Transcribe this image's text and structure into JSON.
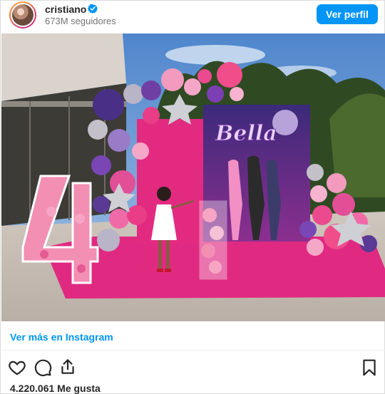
{
  "header": {
    "username": "cristiano",
    "followers": "673M seguidores",
    "follow_label": "Ver perfil"
  },
  "post": {
    "image_alt": "Bella",
    "backdrop_text": "Bella",
    "number_prop": "4"
  },
  "footer": {
    "more_link": "Ver más en Instagram",
    "likes": "4.220.061 Me gusta"
  },
  "icons": {
    "verified": "verified-badge-icon",
    "like": "heart-icon",
    "comment": "comment-icon",
    "share": "share-icon",
    "save": "bookmark-icon"
  },
  "colors": {
    "accent": "#0095f6",
    "text": "#262626",
    "muted": "#737373"
  }
}
